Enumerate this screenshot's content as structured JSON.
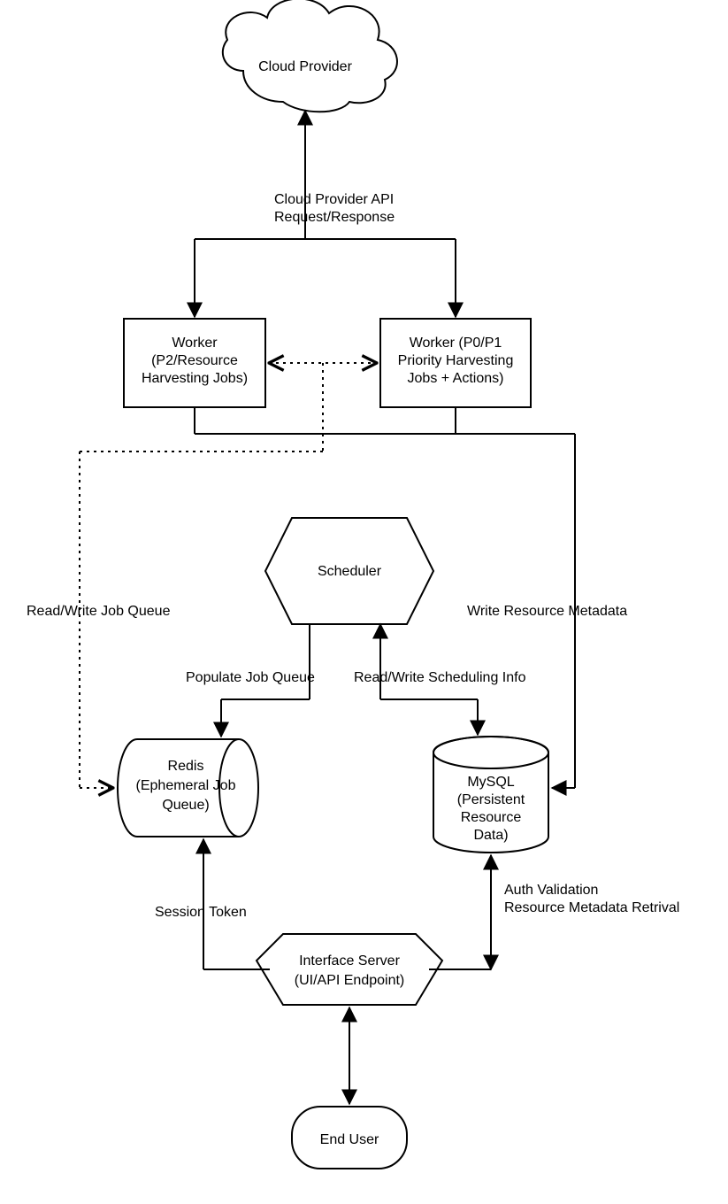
{
  "nodes": {
    "cloud": "Cloud Provider",
    "workerA_l1": "Worker",
    "workerA_l2": "(P2/Resource",
    "workerA_l3": "Harvesting Jobs)",
    "workerB_l1": "Worker (P0/P1",
    "workerB_l2": "Priority Harvesting",
    "workerB_l3": "Jobs + Actions)",
    "scheduler": "Scheduler",
    "redis_l1": "Redis",
    "redis_l2": "(Ephemeral Job",
    "redis_l3": "Queue)",
    "mysql_l1": "MySQL",
    "mysql_l2": "(Persistent",
    "mysql_l3": "Resource",
    "mysql_l4": "Data)",
    "interface_l1": "Interface Server",
    "interface_l2": "(UI/API Endpoint)",
    "enduser": "End User"
  },
  "edges": {
    "cloud_api_l1": "Cloud Provider API",
    "cloud_api_l2": "Request/Response",
    "rw_job_queue": "Read/Write Job Queue",
    "populate_queue": "Populate Job Queue",
    "rw_sched": "Read/Write Scheduling Info",
    "write_meta": "Write Resource Metadata",
    "session_token": "Session Token",
    "auth_l1": "Auth Validation",
    "auth_l2": "Resource Metadata Retrival"
  }
}
